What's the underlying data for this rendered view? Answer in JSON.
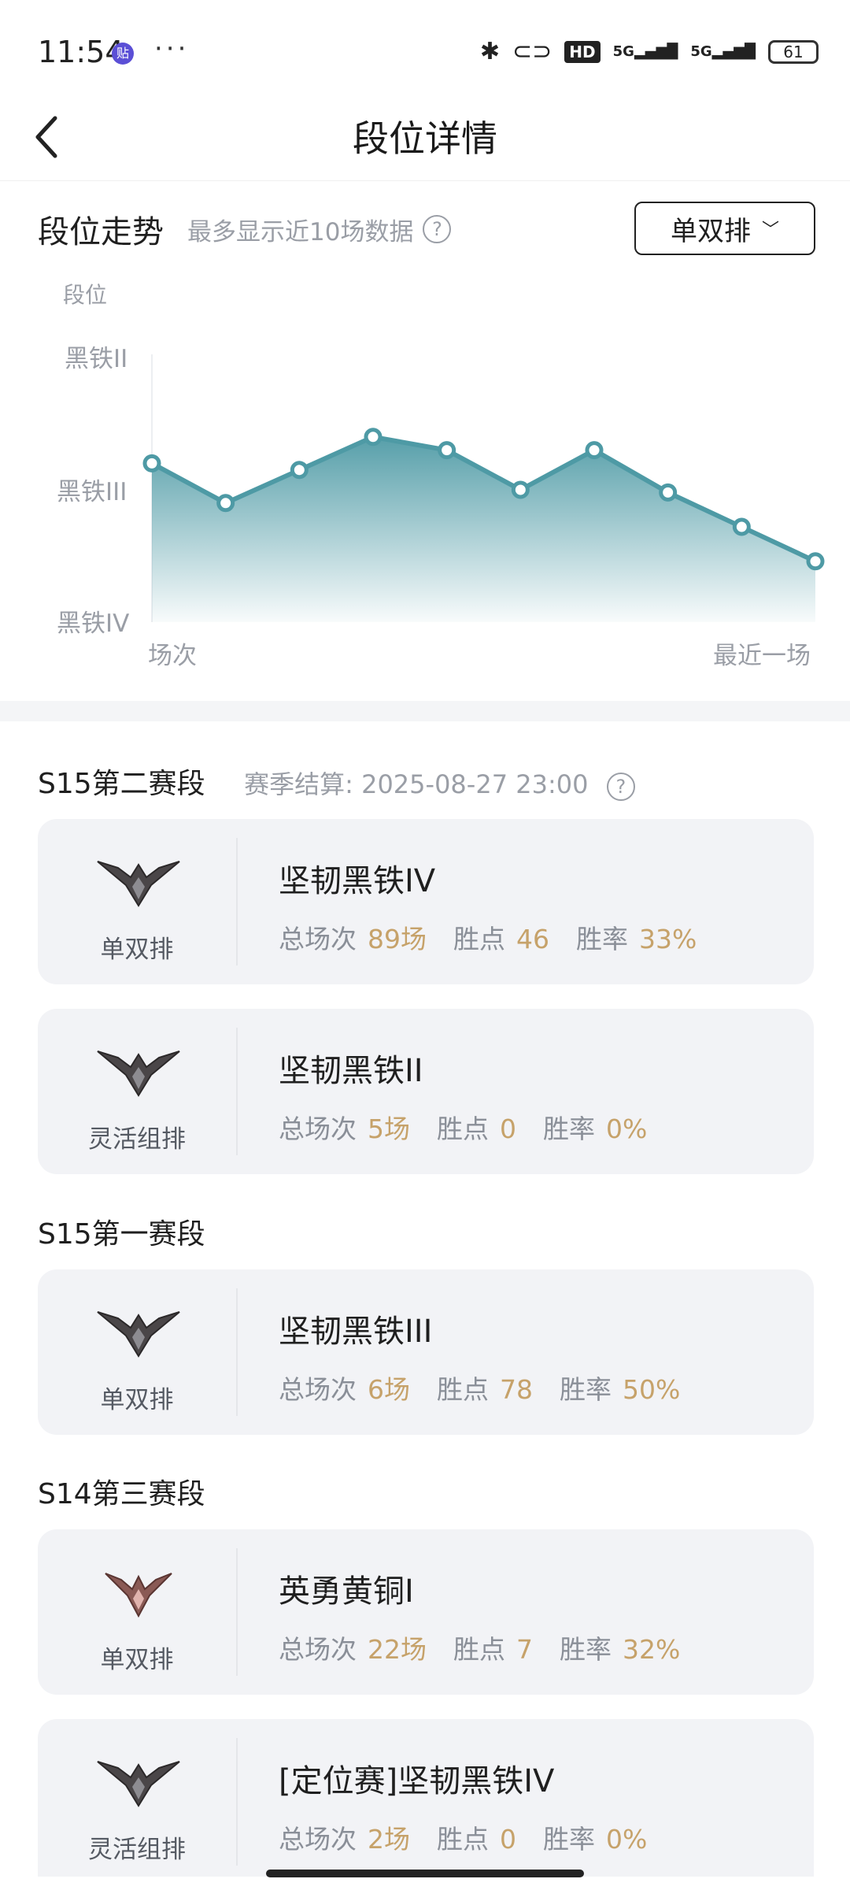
{
  "status_bar": {
    "time": "11:54",
    "notif_badge": "贴",
    "more": "···",
    "hd": "HD",
    "signal1": "5G",
    "signal2": "5G",
    "battery": "61"
  },
  "nav": {
    "title": "段位详情"
  },
  "trend": {
    "title": "段位走势",
    "subtitle": "最多显示近10场数据",
    "help": "?",
    "queue_select": "单双排"
  },
  "chart_data": {
    "type": "area",
    "ylabel": "段位",
    "y_ticks": [
      "黑铁II",
      "黑铁III",
      "黑铁IV"
    ],
    "x_labels": [
      "场次",
      "最近一场"
    ],
    "y_range": [
      0,
      2
    ],
    "values": [
      1.2,
      0.9,
      1.15,
      1.4,
      1.3,
      1.0,
      1.3,
      0.98,
      0.72,
      0.46
    ],
    "color": "#4e9aa5"
  },
  "seasons": [
    {
      "title": "S15第二赛段",
      "settle": "赛季结算: 2025-08-27 23:00",
      "cards": [
        {
          "queue": "单双排",
          "rank": "坚韧黑铁IV",
          "games_label": "总场次",
          "games": "89场",
          "lp_label": "胜点",
          "lp": "46",
          "wr_label": "胜率",
          "wr": "33%"
        },
        {
          "queue": "灵活组排",
          "rank": "坚韧黑铁II",
          "games_label": "总场次",
          "games": "5场",
          "lp_label": "胜点",
          "lp": "0",
          "wr_label": "胜率",
          "wr": "0%"
        }
      ]
    },
    {
      "title": "S15第一赛段",
      "cards": [
        {
          "queue": "单双排",
          "rank": "坚韧黑铁III",
          "games_label": "总场次",
          "games": "6场",
          "lp_label": "胜点",
          "lp": "78",
          "wr_label": "胜率",
          "wr": "50%"
        }
      ]
    },
    {
      "title": "S14第三赛段",
      "cards": [
        {
          "queue": "单双排",
          "rank": "英勇黄铜I",
          "games_label": "总场次",
          "games": "22场",
          "lp_label": "胜点",
          "lp": "7",
          "wr_label": "胜率",
          "wr": "32%"
        },
        {
          "queue": "灵活组排",
          "rank": "[定位赛]坚韧黑铁IV",
          "games_label": "总场次",
          "games": "2场",
          "lp_label": "胜点",
          "lp": "0",
          "wr_label": "胜率",
          "wr": "0%"
        }
      ]
    }
  ],
  "colors": {
    "accent": "#c6a26a",
    "chart_line": "#4e9aa5",
    "iron_emblem": "#4a4648",
    "bronze_emblem": "#8a5a55"
  }
}
